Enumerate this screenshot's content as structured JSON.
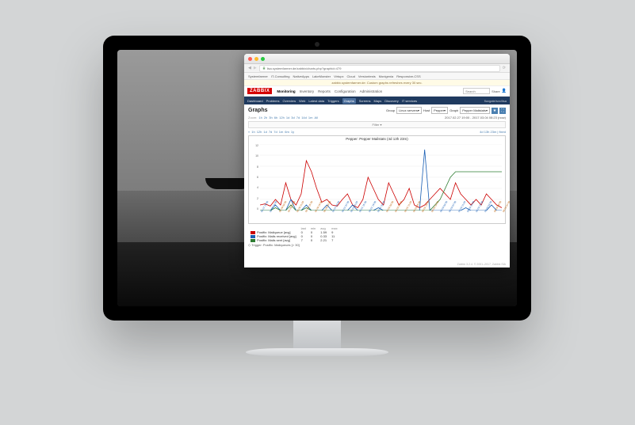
{
  "mac": {
    "url": "lisa.systemfarmer.de/zabbix/charts.php?graphid=479",
    "bookmarks": [
      "Systemfarmer",
      "IT-Consulting",
      "NativeApps",
      "LakeMonster",
      "Virtupx",
      "Cloud",
      "Versiontests",
      "Monigenia",
      "Responsive-CSS"
    ],
    "notice": "zabbix.systemfarmer.de: Custom graphs refreshes every 30 sec."
  },
  "zabbix": {
    "logo": "ZABBIX",
    "main_tabs": [
      "Monitoring",
      "Inventory",
      "Reports",
      "Configuration",
      "Administration"
    ],
    "active_main": "Monitoring",
    "search_placeholder": "Search",
    "share": "Share",
    "sub_tabs": [
      "Dashboard",
      "Problems",
      "Overview",
      "Web",
      "Latest data",
      "Triggers",
      "Graphs",
      "Screens",
      "Maps",
      "Discovery",
      "IT services"
    ],
    "active_sub": "Graphs",
    "sub_right": "fluxgate/svc/lisa"
  },
  "page": {
    "title": "Graphs",
    "group_label": "Group",
    "group_value": "Linux servers",
    "host_label": "Host",
    "host_value": "Pepper",
    "graph_label": "Graph",
    "graph_value": "Pepper Mailstats",
    "zoom_label": "Zoom:",
    "zoom_opts": [
      "1h",
      "2h",
      "3h",
      "6h",
      "12h",
      "1d",
      "3d",
      "7d",
      "14d",
      "1m",
      "All"
    ],
    "filter_label": "Filter ▾",
    "nav_prev": [
      "«",
      "1h",
      "12h",
      "1d",
      "7d",
      "7d",
      "1m",
      "6m",
      "1y"
    ],
    "nav_right": "4d 13h 23m | fixed",
    "date_range": "2017.02.27 19:00 - 2017.03.04 08:23 (now)",
    "now_label": "(now)"
  },
  "chart_data": {
    "type": "line",
    "title": "Pepper: Pepper Mailstats (4d 13h 23m)",
    "ylabel": "",
    "ylim": [
      0,
      12
    ],
    "yticks": [
      0,
      2,
      4,
      6,
      8,
      10,
      12
    ],
    "x_tick_labels": [
      "02-27 19:00",
      "02-27 23:00",
      "02-28 03:00",
      "02-28 07:00",
      "02-28 11:00",
      "02-28 15:00",
      "02-28 19:00",
      "02-28 23:00",
      "03-01 03:00",
      "03-01 07:00",
      "03-01 11:00",
      "03-01 15:00",
      "03-01 19:00",
      "03-01 23:00",
      "03-02 03:00",
      "03-02 07:00",
      "03-02 11:00",
      "03-02 15:00",
      "03-02 19:00",
      "03-02 23:00",
      "03-03 03:00",
      "03-03 07:00",
      "03-03 11:00",
      "03-03 15:00",
      "03-03 19:00",
      "03-03 23:00",
      "03-04 03:00",
      "03-04 07:00"
    ],
    "series": [
      {
        "name": "Postfix: Mailqueue",
        "color": "#cc0000",
        "agg": "avg",
        "values": [
          1,
          1.2,
          0.8,
          2,
          1,
          5,
          2,
          1,
          3,
          9,
          7,
          4,
          1.5,
          2,
          1,
          0.8,
          2,
          3,
          1,
          0.5,
          2,
          6,
          4,
          2,
          1,
          5,
          3,
          1,
          2,
          4,
          1,
          0.5,
          1,
          2,
          3,
          4,
          3,
          2,
          5,
          3,
          2,
          1,
          2,
          1,
          3,
          2,
          1,
          0.5
        ]
      },
      {
        "name": "Postfix: Mails received",
        "color": "#1a5fb4",
        "agg": "avg",
        "values": [
          0,
          0,
          0,
          1,
          0,
          0,
          2,
          0,
          0,
          1,
          0,
          0,
          0,
          1,
          0,
          0,
          0,
          0,
          1,
          0,
          0,
          0,
          0,
          0.5,
          0,
          0,
          0,
          0,
          0,
          0,
          0,
          0,
          11,
          0,
          0,
          0,
          0,
          0,
          0,
          0,
          0.5,
          0,
          0,
          0,
          0,
          1,
          0,
          0
        ]
      },
      {
        "name": "Postfix: Mails sent",
        "color": "#2e7d32",
        "agg": "avg",
        "values": [
          0,
          0,
          0,
          0.5,
          0,
          0,
          1,
          0,
          0,
          0.5,
          0,
          0,
          0,
          0,
          0,
          0,
          0,
          0,
          0,
          0,
          0,
          0,
          0,
          0,
          0,
          0,
          0,
          0,
          0,
          0,
          0,
          0,
          0,
          0,
          1,
          2,
          4,
          6,
          7,
          7,
          7,
          7,
          7,
          7,
          7,
          7,
          7,
          7
        ]
      }
    ],
    "legend_cols": [
      "",
      "last",
      "min",
      "avg",
      "max"
    ],
    "legend_rows": [
      {
        "name": "Postfix: Mailqueue",
        "color": "#cc0000",
        "agg": "[avg]",
        "last": "0",
        "min": "0",
        "avg": "1.59",
        "max": "9"
      },
      {
        "name": "Postfix: Mails received",
        "color": "#1a5fb4",
        "agg": "[avg]",
        "last": "0",
        "min": "0",
        "avg": "0.33",
        "max": "11"
      },
      {
        "name": "Postfix: Mails sent",
        "color": "#2e7d32",
        "agg": "[avg]",
        "last": "7",
        "min": "0",
        "avg": "2.21",
        "max": "7"
      }
    ],
    "trigger_line": "Trigger: Postfix: Mailqueues   [> 30]"
  },
  "footer": "Zabbix 3.2.4. © 2001–2017, Zabbix SIA"
}
